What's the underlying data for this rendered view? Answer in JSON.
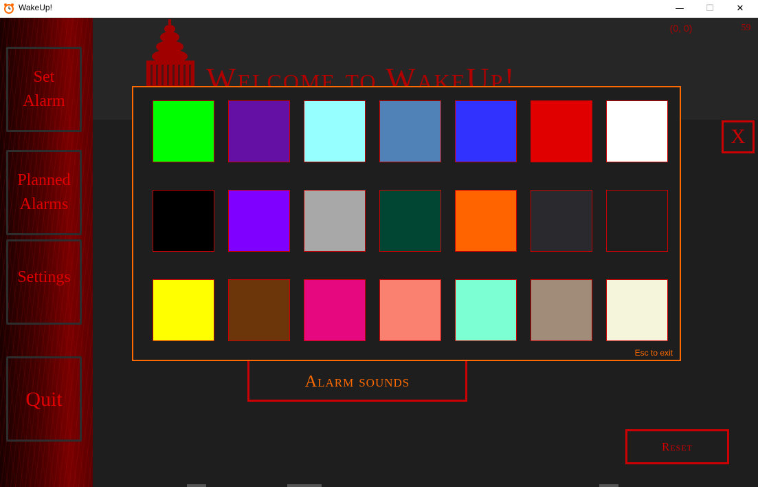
{
  "window": {
    "title": "WakeUp!",
    "minimize": "—",
    "maximize": "☐",
    "close": "✕"
  },
  "sidebar": {
    "items": [
      {
        "line1": "Set",
        "line2": "Alarm"
      },
      {
        "line1": "Planned",
        "line2": "Alarms"
      },
      {
        "line1": "Settings",
        "line2": ""
      },
      {
        "line1": "Quit",
        "line2": ""
      }
    ]
  },
  "header": {
    "welcome": "Welcome to WakeUp!"
  },
  "status": {
    "coords": "(0, 0)",
    "counter": "59"
  },
  "buttons": {
    "close": "X",
    "alarm_sounds": "Alarm sounds",
    "reset": "Reset"
  },
  "color_picker": {
    "esc_hint": "Esc to exit",
    "swatches": [
      "#00ff00",
      "#6410a4",
      "#96ffff",
      "#5082b8",
      "#3232ff",
      "#e00000",
      "#ffffff",
      "#000000",
      "#8000ff",
      "#a8a8a8",
      "#004632",
      "#ff6400",
      "#2a2a2e",
      "#1e1e1e",
      "#ffff00",
      "#6c360a",
      "#e6087e",
      "#fa8070",
      "#7dffd4",
      "#a08c78",
      "#f5f5dc"
    ]
  },
  "icons": {
    "app": "alarm-clock-icon"
  }
}
